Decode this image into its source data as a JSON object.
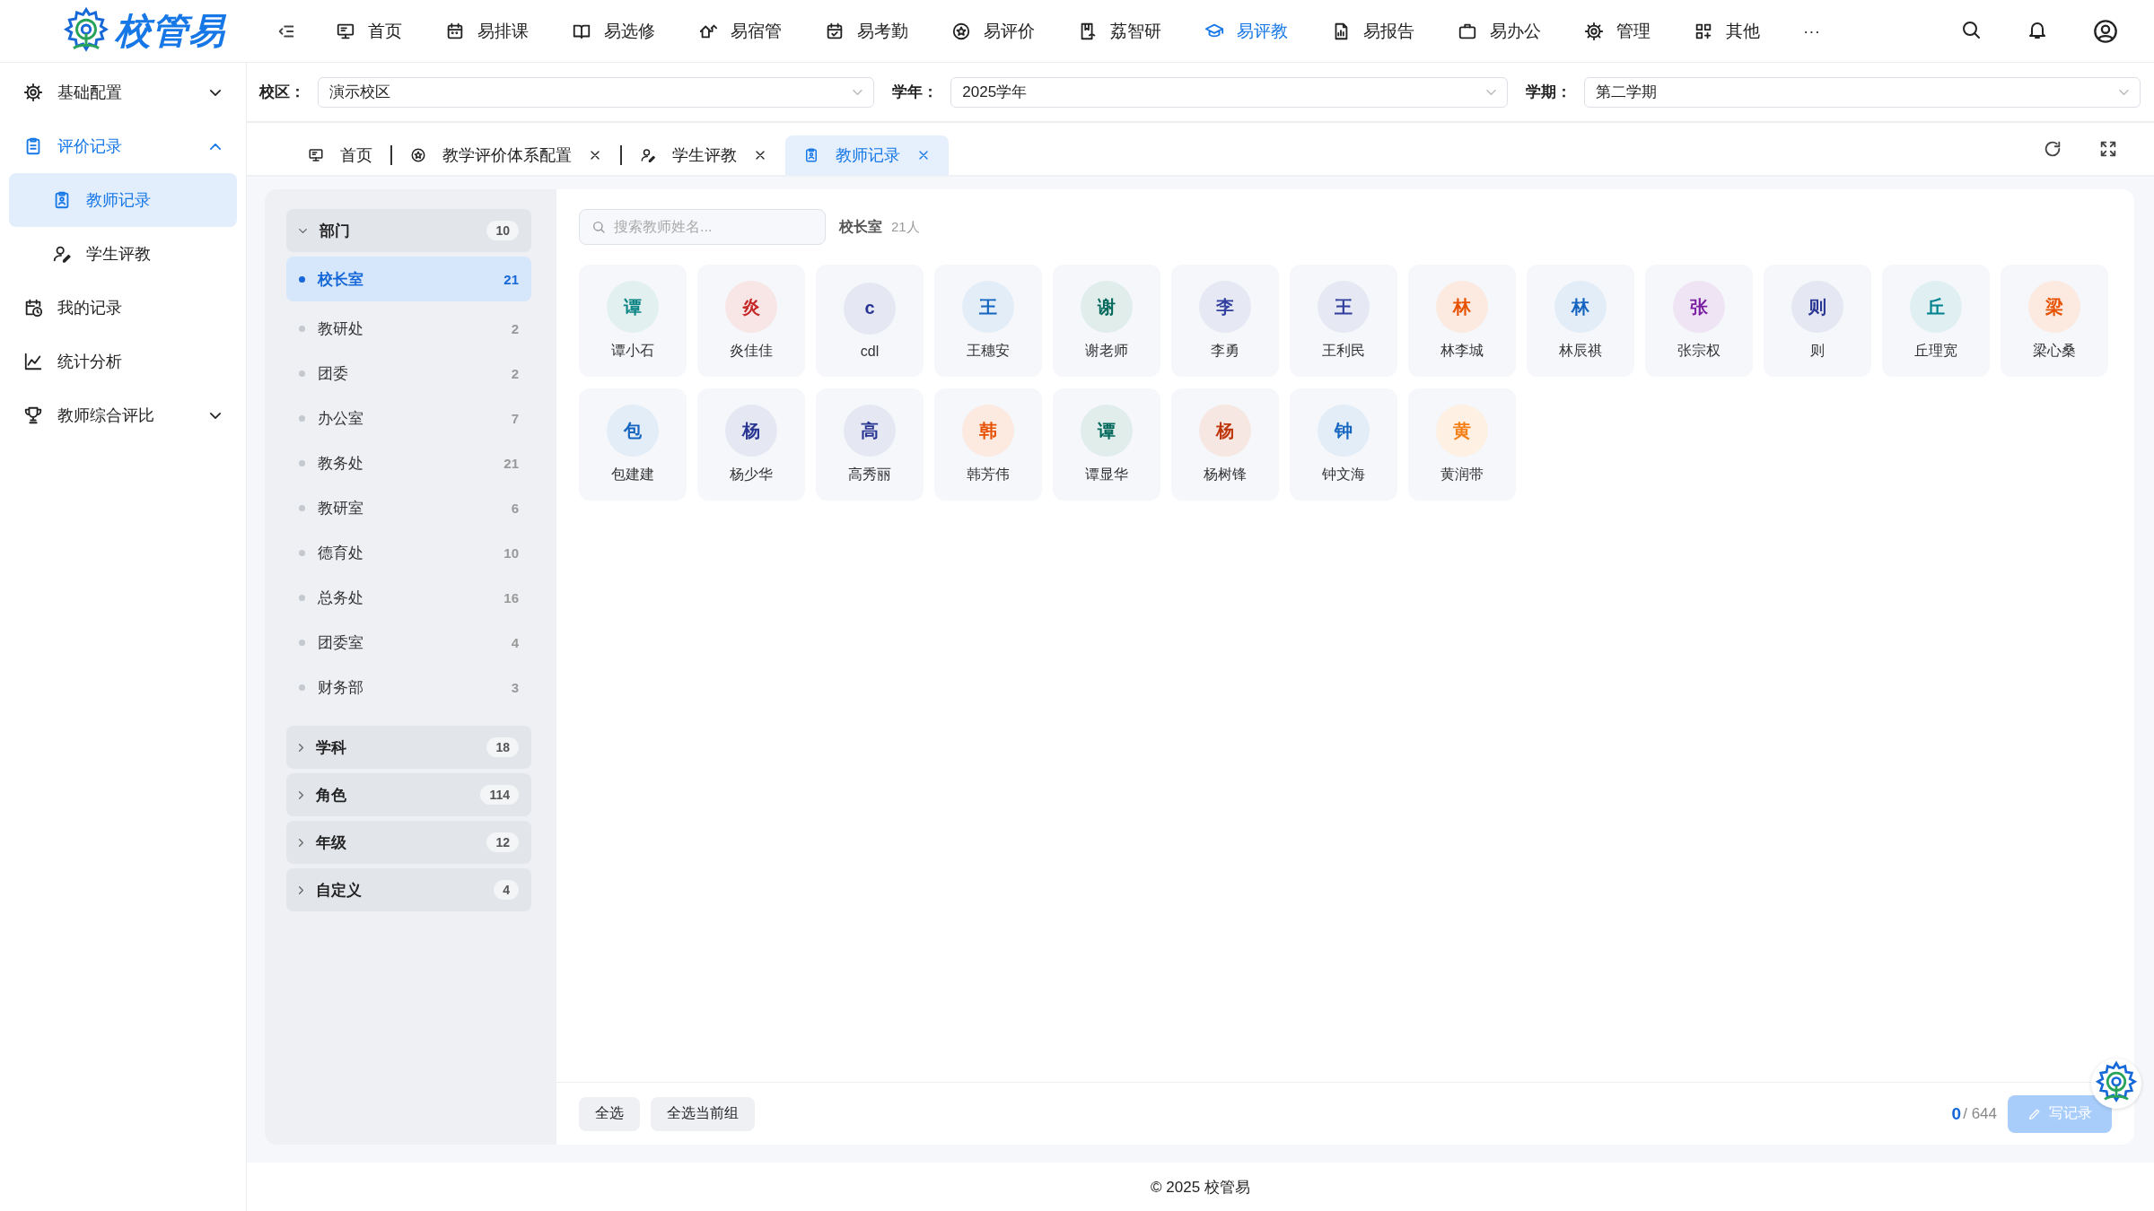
{
  "topbar": {
    "logo": "校管易",
    "nav": [
      {
        "label": "首页",
        "selected": false
      },
      {
        "label": "易排课",
        "selected": false
      },
      {
        "label": "易选修",
        "selected": false
      },
      {
        "label": "易宿管",
        "selected": false
      },
      {
        "label": "易考勤",
        "selected": false
      },
      {
        "label": "易评价",
        "selected": false
      },
      {
        "label": "荔智研",
        "selected": false
      },
      {
        "label": "易评教",
        "selected": true
      },
      {
        "label": "易报告",
        "selected": false
      },
      {
        "label": "易办公",
        "selected": false
      },
      {
        "label": "管理",
        "selected": false
      },
      {
        "label": "其他",
        "selected": false
      }
    ],
    "more": "···"
  },
  "sidebar": {
    "items": [
      {
        "label": "基础配置",
        "expanded": false
      },
      {
        "label": "评价记录",
        "expanded": true,
        "children": [
          {
            "label": "教师记录",
            "selected": true
          },
          {
            "label": "学生评教",
            "selected": false
          }
        ]
      },
      {
        "label": "我的记录"
      },
      {
        "label": "统计分析"
      },
      {
        "label": "教师综合评比",
        "expanded": false
      }
    ]
  },
  "filters": [
    {
      "label": "校区：",
      "value": "演示校区"
    },
    {
      "label": "学年：",
      "value": "2025学年"
    },
    {
      "label": "学期：",
      "value": "第二学期"
    }
  ],
  "tabs": [
    {
      "label": "首页",
      "closable": false,
      "selected": false
    },
    {
      "label": "教学评价体系配置",
      "closable": true,
      "selected": false
    },
    {
      "label": "学生评教",
      "closable": true,
      "selected": false
    },
    {
      "label": "教师记录",
      "closable": true,
      "selected": true
    }
  ],
  "groups": [
    {
      "label": "部门",
      "count": "10",
      "expanded": true,
      "items": [
        {
          "label": "校长室",
          "count": "21",
          "selected": true
        },
        {
          "label": "教研处",
          "count": "2",
          "selected": false
        },
        {
          "label": "团委",
          "count": "2",
          "selected": false
        },
        {
          "label": "办公室",
          "count": "7",
          "selected": false
        },
        {
          "label": "教务处",
          "count": "21",
          "selected": false
        },
        {
          "label": "教研室",
          "count": "6",
          "selected": false
        },
        {
          "label": "德育处",
          "count": "10",
          "selected": false
        },
        {
          "label": "总务处",
          "count": "16",
          "selected": false
        },
        {
          "label": "团委室",
          "count": "4",
          "selected": false
        },
        {
          "label": "财务部",
          "count": "3",
          "selected": false
        }
      ]
    },
    {
      "label": "学科",
      "count": "18",
      "expanded": false
    },
    {
      "label": "角色",
      "count": "114",
      "expanded": false
    },
    {
      "label": "年级",
      "count": "12",
      "expanded": false
    },
    {
      "label": "自定义",
      "count": "4",
      "expanded": false
    }
  ],
  "teachers": {
    "search": {
      "placeholder": "搜索教师姓名..."
    },
    "group_name": "校长室",
    "group_count": "21人",
    "cards": [
      {
        "initial": "谭",
        "name": "谭小石",
        "color": "#0f8585"
      },
      {
        "initial": "炎",
        "name": "炎佳佳",
        "color": "#c62828"
      },
      {
        "initial": "c",
        "name": "cdl",
        "color": "#283593"
      },
      {
        "initial": "王",
        "name": "王穗安",
        "color": "#1565c0"
      },
      {
        "initial": "谢",
        "name": "谢老师",
        "color": "#00695c"
      },
      {
        "initial": "李",
        "name": "李勇",
        "color": "#303f9f"
      },
      {
        "initial": "王",
        "name": "王利民",
        "color": "#303f9f"
      },
      {
        "initial": "林",
        "name": "林李城",
        "color": "#e65100"
      },
      {
        "initial": "林",
        "name": "林辰祺",
        "color": "#1565c0"
      },
      {
        "initial": "张",
        "name": "张宗权",
        "color": "#7b1fa2"
      },
      {
        "initial": "则",
        "name": "则",
        "color": "#283593"
      },
      {
        "initial": "丘",
        "name": "丘理宽",
        "color": "#00838f"
      },
      {
        "initial": "梁",
        "name": "梁心桑",
        "color": "#e65100"
      },
      {
        "initial": "包",
        "name": "包建建",
        "color": "#1565c0"
      },
      {
        "initial": "杨",
        "name": "杨少华",
        "color": "#283593"
      },
      {
        "initial": "高",
        "name": "高秀丽",
        "color": "#283593"
      },
      {
        "initial": "韩",
        "name": "韩芳伟",
        "color": "#e65100"
      },
      {
        "initial": "谭",
        "name": "谭显华",
        "color": "#00695c"
      },
      {
        "initial": "杨",
        "name": "杨树锋",
        "color": "#bf360c"
      },
      {
        "initial": "钟",
        "name": "钟文海",
        "color": "#1565c0"
      },
      {
        "initial": "黄",
        "name": "黄润带",
        "color": "#f57f17"
      }
    ]
  },
  "actions": {
    "select_all": "全选",
    "select_group": "全选当前组",
    "selected_count": "0",
    "total": "/ 644",
    "write": {
      "label": "写记录",
      "disabled": true
    }
  },
  "footer": "© 2025 校管易"
}
